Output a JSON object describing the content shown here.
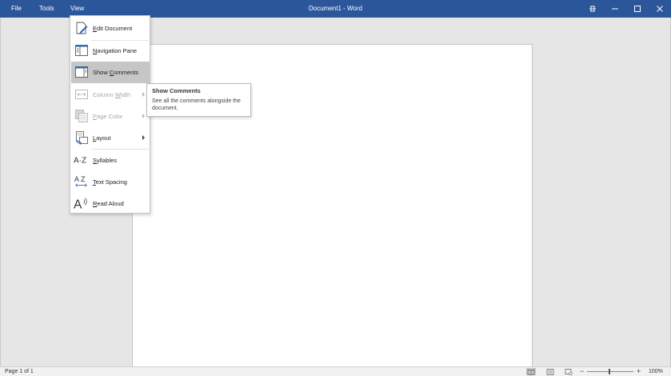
{
  "app": {
    "window_title": "Document1 - Word",
    "accent_color": "#2b579a"
  },
  "menubar": {
    "items": [
      {
        "label": "File"
      },
      {
        "label": "Tools"
      },
      {
        "label": "View"
      }
    ]
  },
  "window_controls": [
    "pin-icon",
    "minimize-icon",
    "maximize-icon",
    "close-icon"
  ],
  "view_menu": {
    "items": [
      {
        "label": "Edit Document",
        "icon": "edit-document-icon",
        "enabled": true
      },
      {
        "label": "Navigation Pane",
        "icon": "navigation-pane-icon",
        "enabled": true
      },
      {
        "label": "Show Comments",
        "icon": "show-comments-icon",
        "enabled": true,
        "selected": true
      },
      {
        "label": "Column Width",
        "icon": "column-width-icon",
        "enabled": false,
        "submenu": true
      },
      {
        "label": "Page Color",
        "icon": "page-color-icon",
        "enabled": false,
        "submenu": true
      },
      {
        "label": "Layout",
        "icon": "layout-icon",
        "enabled": true,
        "submenu": true
      },
      {
        "label": "Syllables",
        "icon": "syllables-icon",
        "enabled": true
      },
      {
        "label": "Text Spacing",
        "icon": "text-spacing-icon",
        "enabled": true
      },
      {
        "label": "Read Aloud",
        "icon": "read-aloud-icon",
        "enabled": true
      }
    ]
  },
  "tooltip": {
    "title": "Show Comments",
    "description": "See all the comments alongside the document."
  },
  "statusbar": {
    "page_info": "Page 1 of 1",
    "views": [
      "read-mode-icon",
      "print-layout-icon",
      "web-layout-icon"
    ],
    "zoom_level": "100%",
    "zoom_minus": "−",
    "zoom_plus": "+"
  }
}
